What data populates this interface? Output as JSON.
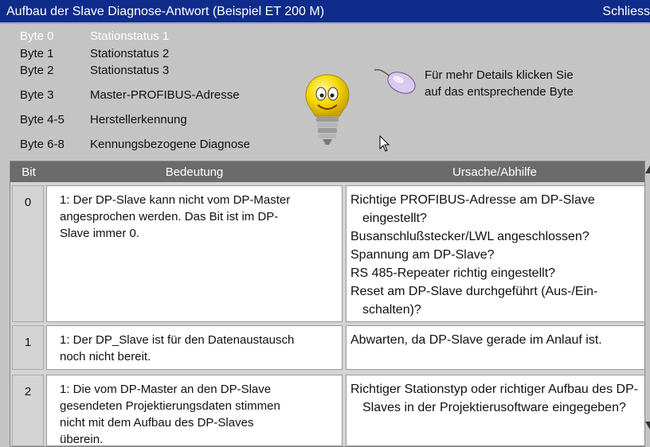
{
  "window": {
    "title": "Aufbau der Slave Diagnose-Antwort (Beispiel ET 200 M)",
    "close_label": "Schliess"
  },
  "bytes": [
    {
      "byte": "Byte 0",
      "label": "Stationstatus 1",
      "active": true
    },
    {
      "byte": "Byte 1",
      "label": "Stationstatus 2",
      "active": false
    },
    {
      "byte": "Byte 2",
      "label": "Stationstatus 3",
      "active": false
    },
    {
      "byte": "Byte 3",
      "label": "Master-PROFIBUS-Adresse",
      "active": false
    },
    {
      "byte": "Byte 4-5",
      "label": "Herstellerkennung",
      "active": false
    },
    {
      "byte": "Byte 6-8",
      "label": "Kennungsbezogene Diagnose",
      "active": false
    }
  ],
  "hint": {
    "line1": "Für mehr Details klicken Sie",
    "line2": "auf das entsprechende Byte"
  },
  "icons": {
    "bulb": "lightbulb-mascot-icon",
    "mouse": "mouse-icon",
    "cursor": "mouse-pointer-icon"
  },
  "colors": {
    "titlebar": "#0f2c8a",
    "background": "#c4c4c4",
    "table_header": "#6b6b6b"
  },
  "table": {
    "headers": {
      "bit": "Bit",
      "bedeutung": "Bedeutung",
      "ursache": "Ursache/Abhilfe"
    },
    "rows": [
      {
        "bit": "0",
        "bedeutung": [
          "1: Der DP-Slave kann nicht vom DP-Master",
          "angesprochen werden. Das Bit ist im DP-",
          "Slave immer 0."
        ],
        "ursache": [
          "Richtige PROFIBUS-Adresse am DP-Slave eingestellt?",
          "Busanschlußstecker/LWL angeschlossen?",
          "Spannung am DP-Slave?",
          "RS 485-Repeater richtig eingestellt?",
          "Reset am DP-Slave durchgeführt (Aus-/Ein-schalten)?"
        ]
      },
      {
        "bit": "1",
        "bedeutung": [
          "1: Der DP_Slave ist für den Datenaustausch",
          "noch nicht bereit."
        ],
        "ursache": [
          "Abwarten, da DP-Slave gerade im Anlauf ist."
        ]
      },
      {
        "bit": "2",
        "bedeutung": [
          "1: Die vom DP-Master an den DP-Slave",
          "gesendeten Projektierungsdaten stimmen",
          "nicht mit dem Aufbau des DP-Slaves",
          "überein."
        ],
        "ursache": [
          "Richtiger Stationstyp oder richtiger Aufbau des DP-Slaves in der Projektierusoftware eingegeben?"
        ]
      }
    ]
  }
}
